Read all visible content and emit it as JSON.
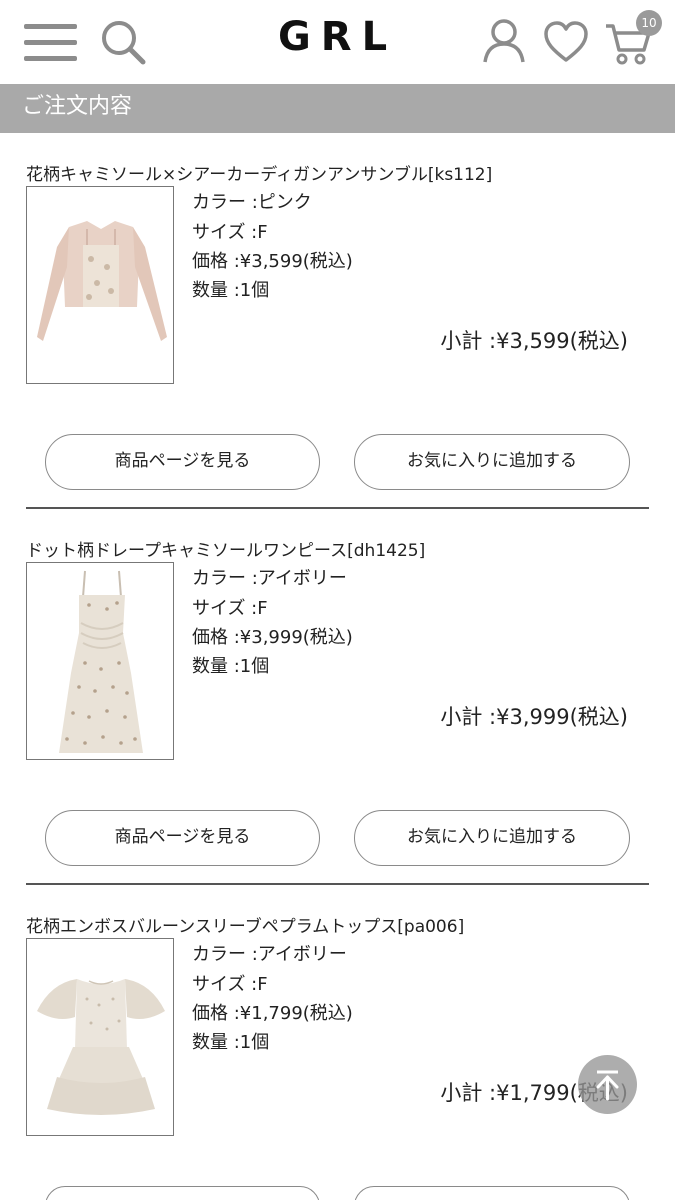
{
  "header": {
    "logo": "GRL",
    "cart_count": "10",
    "icons": [
      "menu-icon",
      "search-icon",
      "user-icon",
      "heart-icon",
      "cart-icon"
    ]
  },
  "section": {
    "title": "ご注文内容"
  },
  "buttons": {
    "product_page": "商品ページを見る",
    "add_favorite": "お気に入りに追加する"
  },
  "items": [
    {
      "name": "花柄キャミソール×シアーカーディガンアンサンブル[ks112]",
      "color": "カラー :ピンク",
      "size": "サイズ :F",
      "price": "価格 :¥3,599(税込)",
      "quantity": "数量 :1個",
      "subtotal": "小計 :¥3,599(税込)"
    },
    {
      "name": "ドット柄ドレープキャミソールワンピース[dh1425]",
      "color": "カラー :アイボリー",
      "size": "サイズ :F",
      "price": "価格 :¥3,999(税込)",
      "quantity": "数量 :1個",
      "subtotal": "小計 :¥3,999(税込)"
    },
    {
      "name": "花柄エンボスバルーンスリーブペプラムトップス[pa006]",
      "color": "カラー :アイボリー",
      "size": "サイズ :F",
      "price": "価格 :¥1,799(税込)",
      "quantity": "数量 :1個",
      "subtotal": "小計 :¥1,799(税込)"
    }
  ],
  "colors": {
    "section_bar": "#a9a9a9",
    "icon_gray": "#8c8c8c",
    "badge": "#9a9a9a"
  }
}
